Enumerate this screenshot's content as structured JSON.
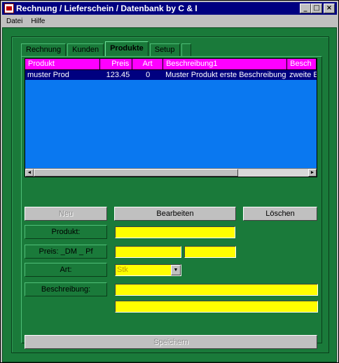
{
  "window": {
    "title": "Rechnung / Lieferschein / Datenbank by C & I",
    "minimize": "_",
    "maximize": "□",
    "close": "×"
  },
  "menu": {
    "items": [
      "Datei",
      "Hilfe"
    ]
  },
  "tabs": [
    "Rechnung",
    "Kunden",
    "Produkte",
    "Setup"
  ],
  "active_tab": "Produkte",
  "table": {
    "columns": [
      "Produkt",
      "Preis",
      "Art",
      "Beschreibung1",
      "Besch"
    ],
    "rows": [
      [
        "muster Prod",
        "123.45",
        "0",
        "Muster Produkt erste Beschreibung",
        "zweite E"
      ]
    ]
  },
  "scrollbar": {
    "left": "◄",
    "right": "►"
  },
  "buttons": {
    "neu": "Neu",
    "bearbeiten": "Bearbeiten",
    "loeschen": "Löschen",
    "speichern": "Speichern"
  },
  "labels": {
    "produkt": "Produkt:",
    "preis": "Preis: _DM _ Pf",
    "art": "Art:",
    "beschreibung": "Beschreibung:"
  },
  "fields": {
    "produkt": "",
    "preis_dm": "",
    "preis_pf": "",
    "art": "Stk",
    "beschreibung1": "",
    "beschreibung2": ""
  },
  "colors": {
    "background": "#1a7a3a",
    "field": "#ffff00",
    "table_bg": "#0a78f0",
    "header": "#ff00ff",
    "selected_row": "#000080"
  }
}
